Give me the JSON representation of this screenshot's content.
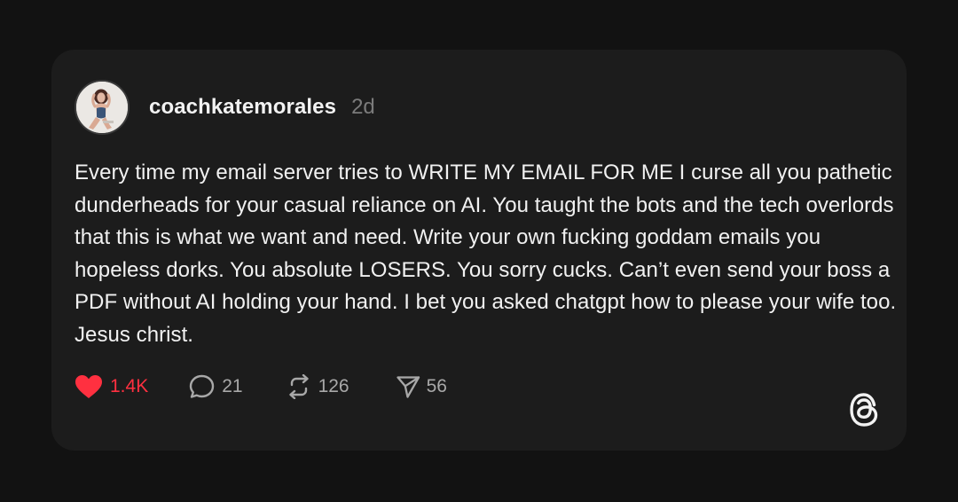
{
  "post": {
    "author": {
      "username": "coachkatemorales",
      "timestamp": "2d"
    },
    "text": "Every time my email server tries to WRITE MY EMAIL FOR ME I curse all you pathetic dunderheads for your casual reliance on AI. You taught the bots and the tech overlords that this is what we want and need. Write your own fucking goddam emails you hopeless dorks. You absolute LOSERS. You sorry cucks. Can’t even send your boss a PDF without AI holding your hand. I bet you asked chatgpt how to please your wife too. Jesus christ.",
    "actions": {
      "likes": "1.4K",
      "replies": "21",
      "reposts": "126",
      "shares": "56"
    },
    "liked": true
  },
  "icons": {
    "like": "heart-icon",
    "reply": "speech-bubble-icon",
    "repost": "repost-arrows-icon",
    "share": "paper-plane-icon",
    "brand": "threads-logo-icon"
  },
  "colors": {
    "background": "#121212",
    "card": "#1c1c1c",
    "like_accent": "#ff3040",
    "text_primary": "#f1f1f1",
    "text_muted": "#7b7b7b"
  }
}
